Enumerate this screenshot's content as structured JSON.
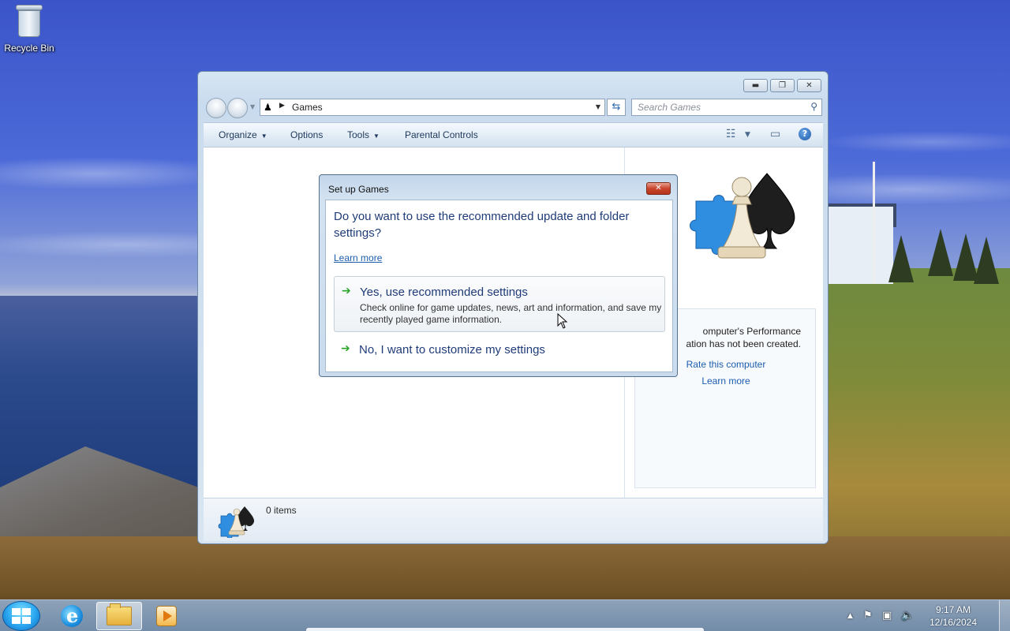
{
  "desktop": {
    "icons": [
      {
        "label": "Recycle Bin",
        "icon": "recycle-bin-icon"
      }
    ]
  },
  "explorer": {
    "address": {
      "location": "Games"
    },
    "search": {
      "placeholder": "Search Games"
    },
    "toolbar": {
      "organize": "Organize",
      "options": "Options",
      "tools": "Tools",
      "parental_controls": "Parental Controls"
    },
    "preview": {
      "perf_line1": "omputer's Performance",
      "perf_line2": "ation has not been created.",
      "rate_link": "Rate this computer",
      "learn_link": "Learn more"
    },
    "details": {
      "item_count": "0 items"
    }
  },
  "dialog": {
    "title": "Set up Games",
    "question": "Do you want to use the recommended update and folder settings?",
    "learn_more": "Learn more",
    "option_yes": {
      "title": "Yes, use recommended settings",
      "description": "Check online for game updates, news, art and information, and save my recently played game information."
    },
    "option_no": {
      "title": "No, I want to customize my settings"
    }
  },
  "taskbar": {
    "pinned": [
      {
        "name": "Internet Explorer",
        "icon": "ie-icon"
      },
      {
        "name": "Windows Explorer",
        "icon": "folder-icon",
        "active": true
      },
      {
        "name": "Windows Media Player",
        "icon": "media-player-icon"
      }
    ],
    "clock": {
      "time": "9:17 AM",
      "date": "12/16/2024"
    }
  },
  "colors": {
    "link": "#1c5cae",
    "dialog_heading": "#1f3b78",
    "option_arrow": "#2aa52a",
    "close_button": "#c9452d"
  }
}
